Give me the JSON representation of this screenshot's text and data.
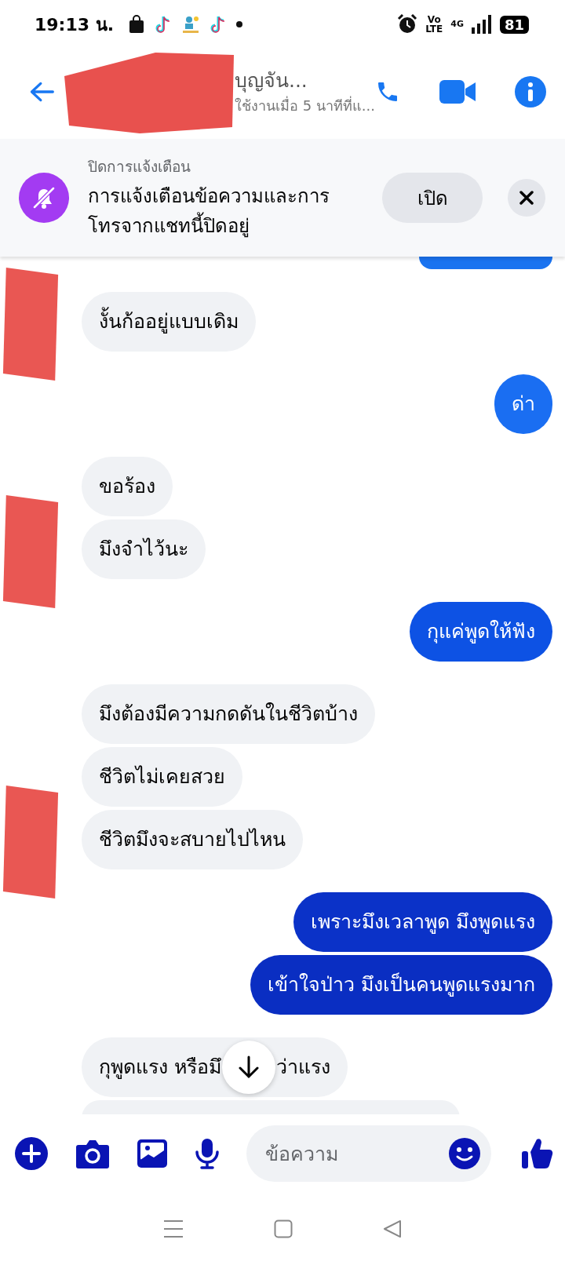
{
  "status_bar": {
    "time": "19:13 น.",
    "volte_top": "Vo",
    "volte_bottom": "LTE",
    "network": "4G",
    "battery": "81"
  },
  "header": {
    "name": "บุญจัน...",
    "status": "ใช้งานเมื่อ 5 นาทีที่แ..."
  },
  "notice": {
    "title": "ปิดการแจ้งเตือน",
    "message": "การแจ้งเตือนข้อความและการ\nโทรจากแชทนี้ปิดอยู่",
    "button": "เปิด"
  },
  "groups": [
    {
      "kind": "outgoing",
      "messages": [
        {
          "kind": "clipped_top",
          "color": "#1a73f0"
        }
      ]
    },
    {
      "kind": "incoming",
      "avatar_redacted": true,
      "messages": [
        {
          "kind": "text",
          "text": "งั้นก้ออยู่แบบเดิม"
        }
      ]
    },
    {
      "kind": "outgoing",
      "messages": [
        {
          "kind": "text",
          "text": "ด่า",
          "color": "#1a6ef2"
        }
      ]
    },
    {
      "kind": "incoming",
      "avatar_redacted": true,
      "messages": [
        {
          "kind": "text",
          "text": "ขอร้อง"
        },
        {
          "kind": "text",
          "text": "มึงจำไว้นะ"
        }
      ]
    },
    {
      "kind": "outgoing",
      "messages": [
        {
          "kind": "text",
          "text": "กุแค่พูดให้ฟัง",
          "color": "#0d52e4"
        }
      ]
    },
    {
      "kind": "incoming",
      "avatar_redacted": true,
      "messages": [
        {
          "kind": "text",
          "text": "มึงต้องมีความกดดันในชีวิตบ้าง"
        },
        {
          "kind": "text",
          "text": "ชีวิตไม่เคยสวย"
        },
        {
          "kind": "text",
          "text": "ชีวิตมึงจะสบายไปไหน"
        }
      ]
    },
    {
      "kind": "outgoing",
      "messages": [
        {
          "kind": "text",
          "text": "เพราะมึงเวลาพูด มึงพูดแรง",
          "color": "#0b32c8"
        },
        {
          "kind": "text",
          "text": "เข้าใจป่าว มึงเป็นคนพูดแรงมาก",
          "color": "#0a2ec2"
        }
      ]
    },
    {
      "kind": "incoming",
      "avatar_redacted": false,
      "messages": [
        {
          "kind": "covered",
          "text_before": "กุพูดแรง หรือมึ",
          "text_after": "ว่าแรง"
        },
        {
          "kind": "clipped_bottom"
        }
      ]
    }
  ],
  "composer": {
    "placeholder": "ข้อความ"
  }
}
